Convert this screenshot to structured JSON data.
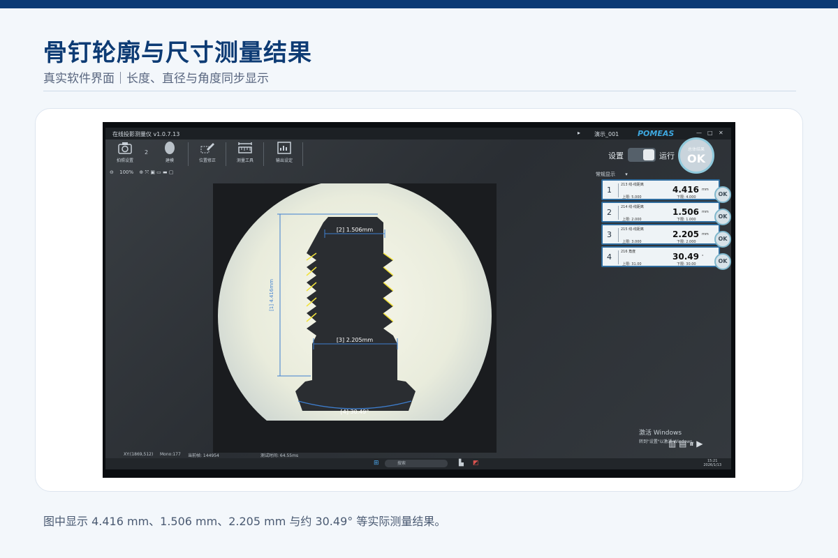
{
  "header": {
    "title": "骨钉轮廓与尺寸测量结果",
    "subtitle": "真实软件界面｜长度、直径与角度同步显示"
  },
  "caption": "图中显示 4.416 mm、1.506 mm、2.205 mm 与约 30.49° 等实际测量结果。",
  "app": {
    "window_title": "在线投影测量仪 v1.0.7.13",
    "file_label": "演示_001",
    "brand": "POMEAS",
    "toolbar": [
      {
        "label": "拍照设置",
        "icon": "camera-icon"
      },
      {
        "label": "建模",
        "icon": "person-model-icon"
      },
      {
        "label": "位置修正",
        "icon": "position-correct-icon"
      },
      {
        "label": "测量工具",
        "icon": "ruler-tool-icon"
      },
      {
        "label": "输出设定",
        "icon": "output-chart-icon"
      }
    ],
    "step_number": "2",
    "zoom": "100%",
    "settings_label": "设置",
    "run_label": "运行",
    "overall": {
      "top": "总体结果",
      "status": "OK"
    },
    "mode_label": "常规显示",
    "results": [
      {
        "index": "1",
        "name": "213 线-线距离",
        "value": "4.416",
        "unit": "mm",
        "upper_label": "上限:",
        "upper": "5.000",
        "lower_label": "下限:",
        "lower": "4.000",
        "status": "OK"
      },
      {
        "index": "2",
        "name": "214 线-线距离",
        "value": "1.506",
        "unit": "mm",
        "upper_label": "上限:",
        "upper": "2.000",
        "lower_label": "下限:",
        "lower": "1.000",
        "status": "OK"
      },
      {
        "index": "3",
        "name": "215 线-线距离",
        "value": "2.205",
        "unit": "mm",
        "upper_label": "上限:",
        "upper": "3.000",
        "lower_label": "下限:",
        "lower": "2.000",
        "status": "OK"
      },
      {
        "index": "4",
        "name": "216 角度",
        "value": "30.49",
        "unit": "°",
        "upper_label": "上限:",
        "upper": "31.00",
        "lower_label": "下限:",
        "lower": "30.00",
        "status": "OK"
      }
    ],
    "annotations": {
      "dim1": "[1] 4.416mm",
      "dim2": "[2] 1.506mm",
      "dim3": "[3] 2.205mm",
      "dim4": "[4] 30.49°"
    },
    "statusbar": {
      "xy": "XY:(1869,512)",
      "mono": "Mono:177",
      "frame": "当前帧: 144954",
      "time": "测试时间: 64.55ms"
    },
    "watermark": {
      "line1": "激活 Windows",
      "line2": "转到\"设置\"以激活 Windows。"
    },
    "taskbar": {
      "search": "搜索",
      "time": "15:21",
      "date": "2026/1/13"
    }
  },
  "colors": {
    "accent": "#0d3b74",
    "annotation": "#3e7fd0",
    "edge": "#f2e23a",
    "ok_border": "#7fb7cc"
  }
}
